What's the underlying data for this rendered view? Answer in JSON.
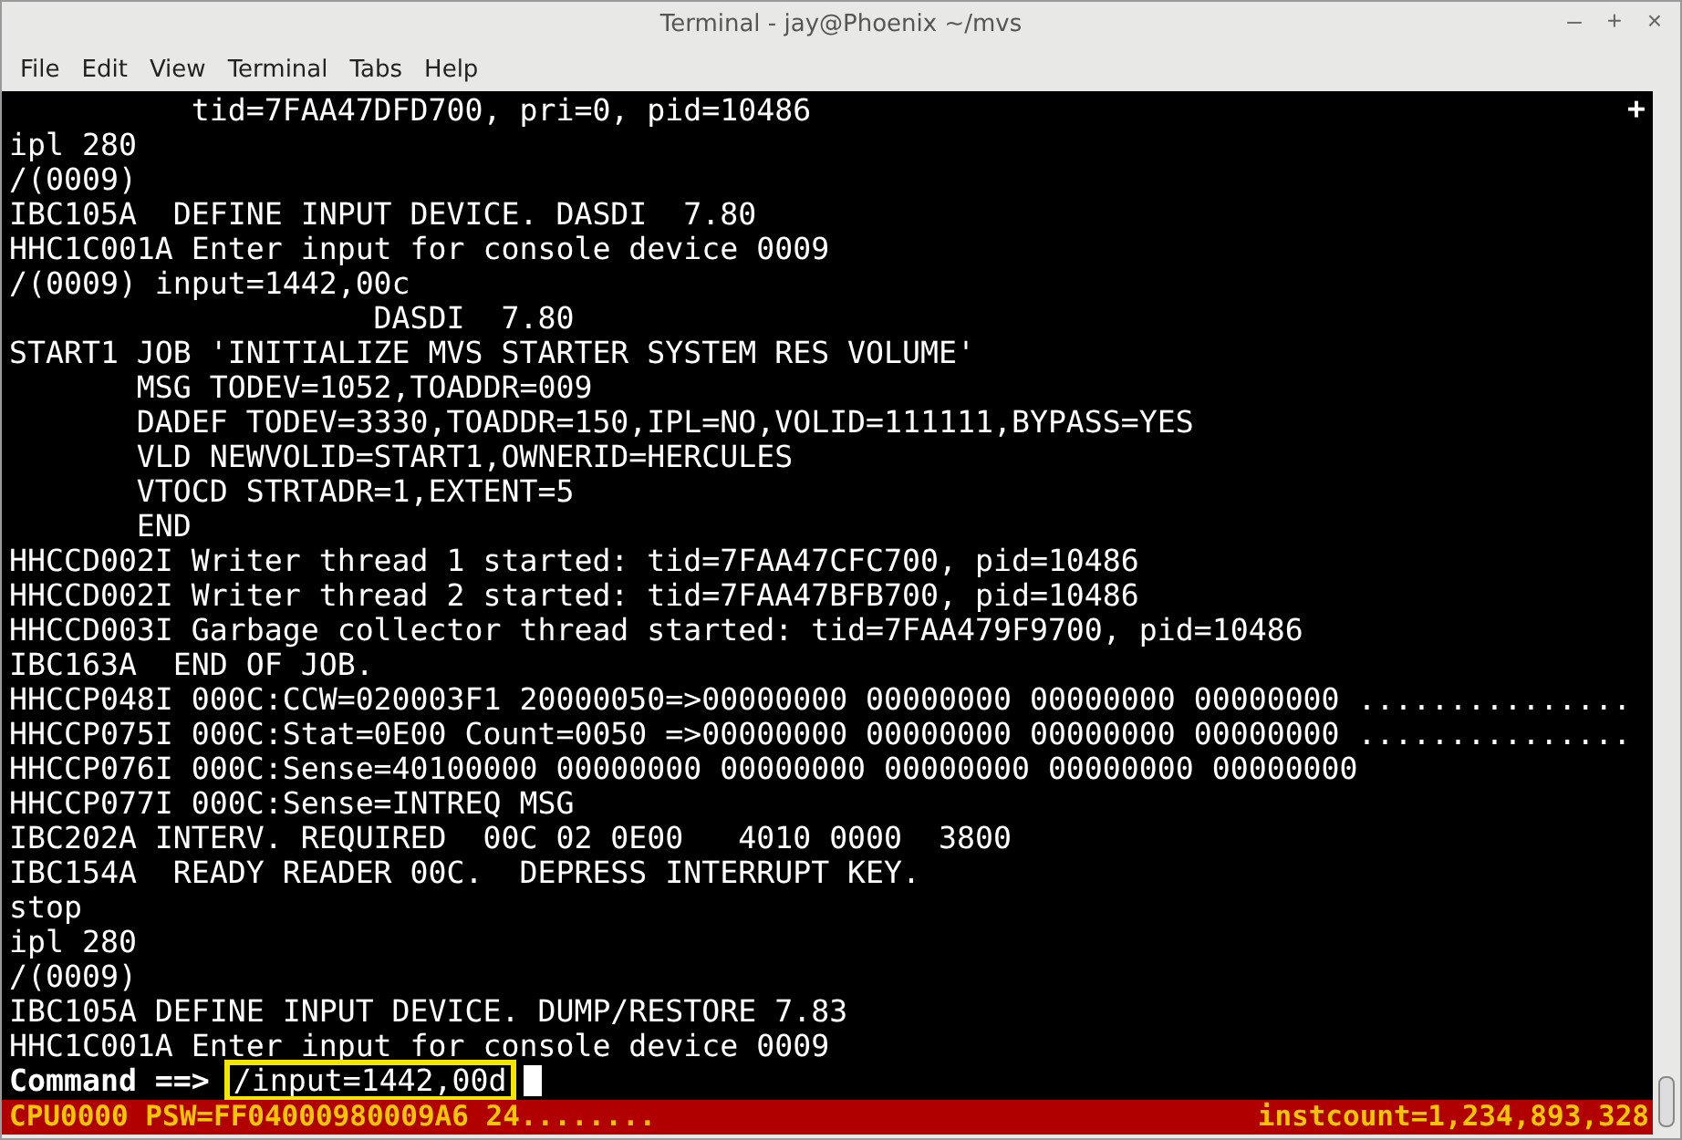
{
  "window": {
    "title": "Terminal - jay@Phoenix ~/mvs",
    "controls": [
      "–",
      "+",
      "×"
    ]
  },
  "menu": [
    "File",
    "Edit",
    "View",
    "Terminal",
    "Tabs",
    "Help"
  ],
  "terminal": {
    "corner_mark": "+",
    "lines": [
      "          tid=7FAA47DFD700, pri=0, pid=10486",
      "ipl 280",
      "/(0009)",
      "IBC105A  DEFINE INPUT DEVICE. DASDI  7.80",
      "HHC1C001A Enter input for console device 0009",
      "/(0009) input=1442,00c",
      "                    DASDI  7.80",
      "START1 JOB 'INITIALIZE MVS STARTER SYSTEM RES VOLUME'",
      "       MSG TODEV=1052,TOADDR=009",
      "       DADEF TODEV=3330,TOADDR=150,IPL=NO,VOLID=111111,BYPASS=YES",
      "       VLD NEWVOLID=START1,OWNERID=HERCULES",
      "       VTOCD STRTADR=1,EXTENT=5",
      "       END",
      "HHCCD002I Writer thread 1 started: tid=7FAA47CFC700, pid=10486",
      "HHCCD002I Writer thread 2 started: tid=7FAA47BFB700, pid=10486",
      "HHCCD003I Garbage collector thread started: tid=7FAA479F9700, pid=10486",
      "IBC163A  END OF JOB.",
      "HHCCP048I 000C:CCW=020003F1 20000050=>00000000 00000000 00000000 00000000 ...............",
      "HHCCP075I 000C:Stat=0E00 Count=0050 =>00000000 00000000 00000000 00000000 ...............",
      "HHCCP076I 000C:Sense=40100000 00000000 00000000 00000000 00000000 00000000",
      "HHCCP077I 000C:Sense=INTREQ MSG",
      "IBC202A INTERV. REQUIRED  00C 02 0E00   4010 0000  3800",
      "IBC154A  READY READER 00C.  DEPRESS INTERRUPT KEY.",
      "stop",
      "ipl 280",
      "/(0009)",
      "IBC105A DEFINE INPUT DEVICE. DUMP/RESTORE 7.83",
      "HHC1C001A Enter input for console device 0009"
    ],
    "command": {
      "prompt": "Command ==> ",
      "value": "/input=1442,00d",
      "highlighted": true
    },
    "status_bar": {
      "left": "CPU0000 PSW=FF04000980009A6 24........",
      "right": "instcount=1,234,893,328"
    }
  }
}
